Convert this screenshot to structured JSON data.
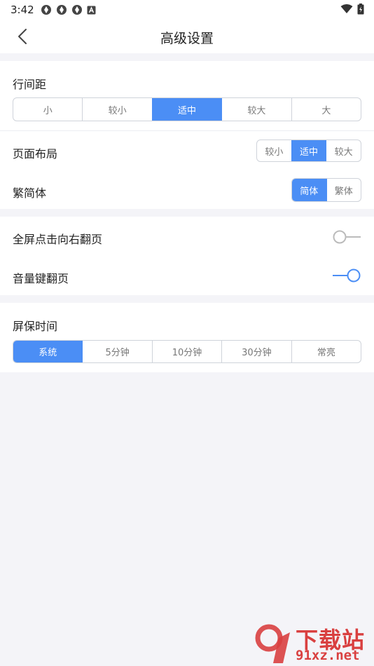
{
  "status_bar": {
    "time": "3:42"
  },
  "header": {
    "title": "高级设置"
  },
  "line_spacing": {
    "label": "行间距",
    "options": [
      "小",
      "较小",
      "适中",
      "较大",
      "大"
    ],
    "selected": "适中"
  },
  "page_layout": {
    "label": "页面布局",
    "options": [
      "较小",
      "适中",
      "较大"
    ],
    "selected": "适中"
  },
  "script_type": {
    "label": "繁简体",
    "options": [
      "简体",
      "繁体"
    ],
    "selected": "简体"
  },
  "fullscreen_tap": {
    "label": "全屏点击向右翻页",
    "enabled": false
  },
  "volume_key": {
    "label": "音量键翻页",
    "enabled": true
  },
  "screen_saver": {
    "label": "屏保时间",
    "options": [
      "系统",
      "5分钟",
      "10分钟",
      "30分钟",
      "常亮"
    ],
    "selected": "系统"
  },
  "watermark": {
    "line1": "下载站",
    "line2": "91xz.net"
  },
  "colors": {
    "accent": "#4b8ef5",
    "watermark": "#d94040"
  }
}
